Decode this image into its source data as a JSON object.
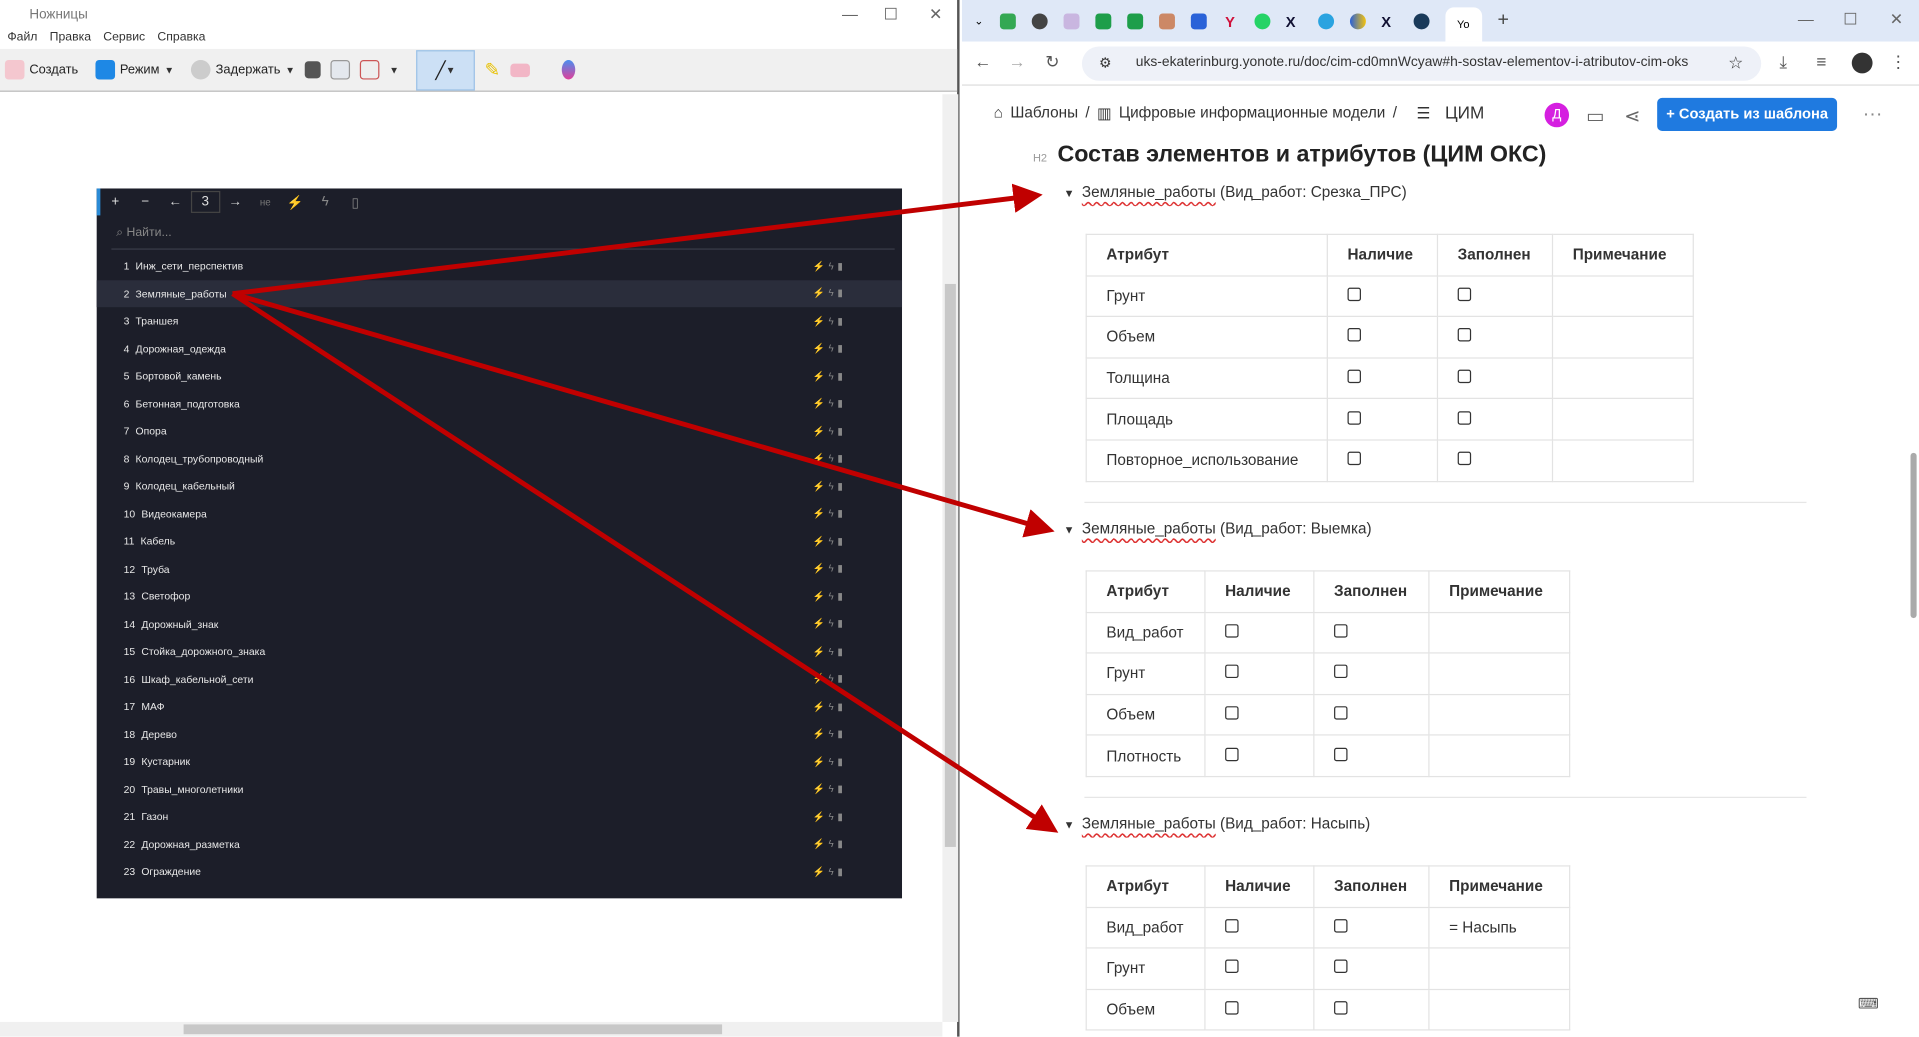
{
  "snip": {
    "title": "Ножницы",
    "menu": [
      "Файл",
      "Правка",
      "Сервис",
      "Справка"
    ],
    "toolbar": {
      "new": "Создать",
      "mode": "Режим",
      "delay": "Задержать"
    }
  },
  "panel": {
    "toolbar": [
      "+",
      "−",
      "←",
      "3",
      "→",
      "не",
      "⚡",
      "ϟ",
      "▯"
    ],
    "search_placeholder": "Найти...",
    "items": [
      {
        "n": "1",
        "label": "Инж_сети_перспектив"
      },
      {
        "n": "2",
        "label": "Земляные_работы"
      },
      {
        "n": "3",
        "label": "Траншея"
      },
      {
        "n": "4",
        "label": "Дорожная_одежда"
      },
      {
        "n": "5",
        "label": "Бортовой_камень"
      },
      {
        "n": "6",
        "label": "Бетонная_подготовка"
      },
      {
        "n": "7",
        "label": "Опора"
      },
      {
        "n": "8",
        "label": "Колодец_трубопроводный"
      },
      {
        "n": "9",
        "label": "Колодец_кабельный"
      },
      {
        "n": "10",
        "label": "Видеокамера"
      },
      {
        "n": "11",
        "label": "Кабель"
      },
      {
        "n": "12",
        "label": "Труба"
      },
      {
        "n": "13",
        "label": "Светофор"
      },
      {
        "n": "14",
        "label": "Дорожный_знак"
      },
      {
        "n": "15",
        "label": "Стойка_дорожного_знака"
      },
      {
        "n": "16",
        "label": "Шкаф_кабельной_сети"
      },
      {
        "n": "17",
        "label": "МАФ"
      },
      {
        "n": "18",
        "label": "Дерево"
      },
      {
        "n": "19",
        "label": "Кустарник"
      },
      {
        "n": "20",
        "label": "Травы_многолетники"
      },
      {
        "n": "21",
        "label": "Газон"
      },
      {
        "n": "22",
        "label": "Дорожная_разметка"
      },
      {
        "n": "23",
        "label": "Ограждение"
      }
    ],
    "selected": "2"
  },
  "browser": {
    "url": "uks-ekaterinburg.yonote.ru/doc/cim-cd0mnWcyaw#h-sostav-elementov-i-atributov-cim-oks",
    "breadcrumb": [
      "Шаблоны",
      "Цифровые информационные модели",
      "ЦИМ"
    ],
    "avatar": "Д",
    "create_button": "Создать из шаблона",
    "h2_tag": "H2",
    "heading": "Состав элементов и атрибутов (ЦИМ ОКС)",
    "columns": [
      "Атрибут",
      "Наличие",
      "Заполнен",
      "Примечание"
    ],
    "sections": [
      {
        "name": "Земляные_работы",
        "suffix": " (Вид_работ: Срезка_ПРС)",
        "rows": [
          {
            "attr": "Грунт",
            "note": ""
          },
          {
            "attr": "Объем",
            "note": ""
          },
          {
            "attr": "Толщина",
            "note": ""
          },
          {
            "attr": "Площадь",
            "note": ""
          },
          {
            "attr": "Повторное_использование",
            "note": ""
          }
        ]
      },
      {
        "name": "Земляные_работы",
        "suffix": " (Вид_работ: Выемка)",
        "rows": [
          {
            "attr": "Вид_работ",
            "note": ""
          },
          {
            "attr": "Грунт",
            "note": ""
          },
          {
            "attr": "Объем",
            "note": ""
          },
          {
            "attr": "Плотность",
            "note": ""
          }
        ]
      },
      {
        "name": "Земляные_работы",
        "suffix": " (Вид_работ: Насыпь)",
        "rows": [
          {
            "attr": "Вид_работ",
            "note": "= Насыпь"
          },
          {
            "attr": "Грунт",
            "note": ""
          },
          {
            "attr": "Объем",
            "note": ""
          }
        ]
      }
    ]
  },
  "colors": {
    "arrow": "#c00000",
    "accent": "#1f7ae0",
    "panel_bg": "#1c1e29"
  }
}
